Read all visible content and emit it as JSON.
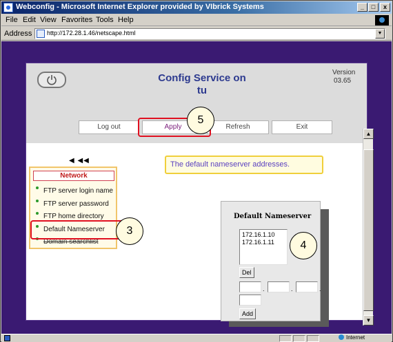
{
  "window": {
    "title": "Webconfig - Microsoft Internet Explorer provided by VIbrick Systems",
    "minimize": "_",
    "maximize": "□",
    "close": "x"
  },
  "menu": [
    "File",
    "Edit",
    "View",
    "Favorites",
    "Tools",
    "Help"
  ],
  "address": {
    "label": "Address",
    "url": "http://172.28.1.46/netscape.html"
  },
  "header": {
    "title_line1": "Config Service on",
    "title_line2": "tu",
    "version_label": "Version",
    "version_value": "03.65"
  },
  "nav_buttons": {
    "logout": "Log out",
    "apply": "Apply",
    "refresh": "Refresh",
    "exit": "Exit"
  },
  "callouts": {
    "apply": "5",
    "menu": "3",
    "nameserver": "4"
  },
  "back_arrows": "◀ ◀◀",
  "network_menu": {
    "header": "Network",
    "items": [
      "FTP server login name",
      "FTP server password",
      "FTP home directory",
      "Default Nameserver",
      "Domain searchlist"
    ]
  },
  "info_message": "The default nameserver addresses.",
  "nameserver_panel": {
    "title": "Default Nameserver",
    "list": [
      "172.16.1.10",
      "172.16.1.11"
    ],
    "del_label": "Del",
    "add_label": "Add"
  },
  "status_bar": {
    "zone": "Internet"
  },
  "colors": {
    "page_background": "#3a1a72",
    "title_text": "#2d3a8f",
    "callout_red": "#e01020",
    "menu_border": "#f1c56a",
    "info_border": "#f0cf3a"
  }
}
